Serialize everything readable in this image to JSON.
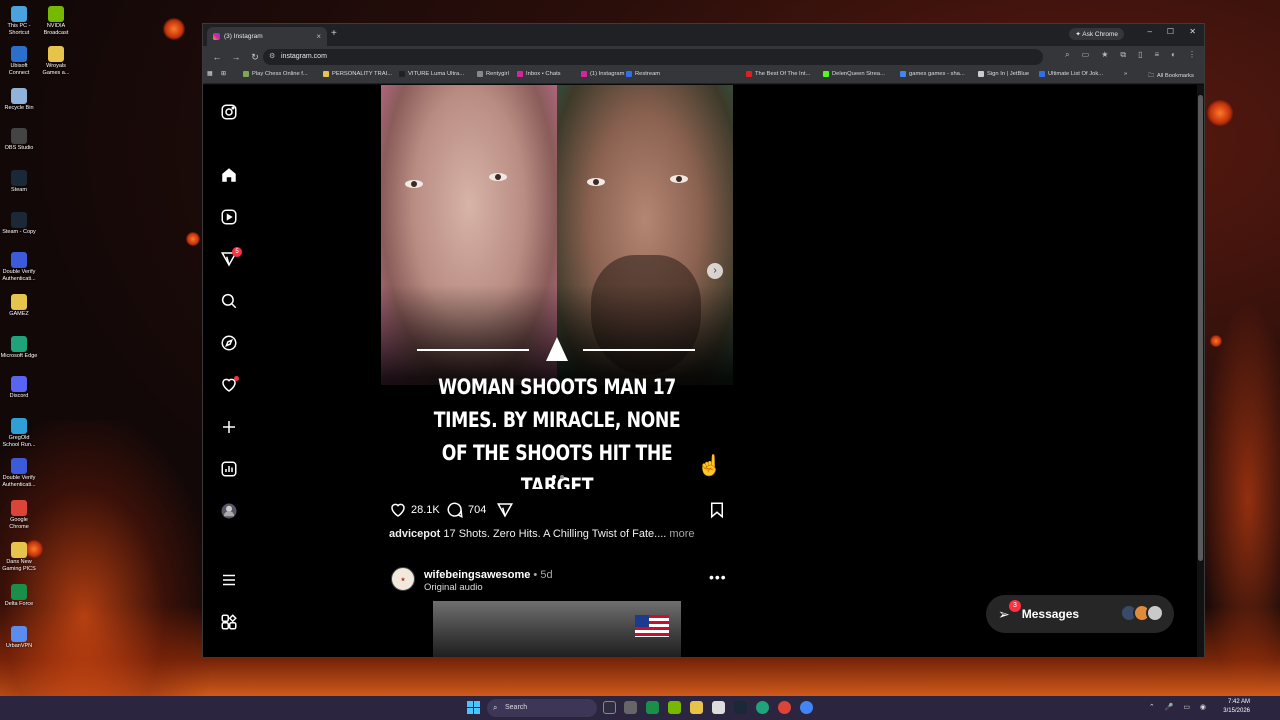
{
  "desktop": {
    "icons": [
      {
        "label": "This PC - Shortcut",
        "color": "#4aa3df"
      },
      {
        "label": "NVIDIA Broadcast",
        "color": "#76b900"
      },
      {
        "label": "Ubisoft Connect",
        "color": "#2c6ecb"
      },
      {
        "label": "Wroyals Games a...",
        "color": "#e6c34a"
      },
      {
        "label": "Recycle Bin",
        "color": "#8fb3d9"
      },
      {
        "label": "OBS Studio",
        "color": "#444"
      },
      {
        "label": "Steam",
        "color": "#1b2838"
      },
      {
        "label": "Steam - Copy",
        "color": "#1b2838"
      },
      {
        "label": "Double Verify Authenticati...",
        "color": "#3b5bdb"
      },
      {
        "label": "GAMEZ",
        "color": "#e6c34a"
      },
      {
        "label": "Microsoft Edge",
        "color": "#1fa37a"
      },
      {
        "label": "Discord",
        "color": "#5865f2"
      },
      {
        "label": "GregOld School Run...",
        "color": "#2f9fd8"
      },
      {
        "label": "Double Verify Authenticati...",
        "color": "#3b5bdb"
      },
      {
        "label": "Google Chrome",
        "color": "#db4437"
      },
      {
        "label": "Dans New Gaming PICS",
        "color": "#e6c34a"
      },
      {
        "label": "Delta Force",
        "color": "#1a8f4a"
      },
      {
        "label": "UrbanVPN",
        "color": "#5a8dee"
      }
    ]
  },
  "browser": {
    "tab_title": "(3) Instagram",
    "new_tab": "+",
    "ask_chrome": "Ask Chrome",
    "url": "instagram.com",
    "window_controls": {
      "minimize": "–",
      "maximize": "☐",
      "close": "✕"
    },
    "nav": {
      "back": "←",
      "forward": "→",
      "reload": "↻"
    },
    "bookmarks": [
      {
        "label": "Play Chess Online f...",
        "color": "#7fa650"
      },
      {
        "label": "PERSONALITY TRAI...",
        "color": "#e6c34a"
      },
      {
        "label": "VITURE Luma Ultra...",
        "color": "#222"
      },
      {
        "label": "Rentygirl",
        "color": "#888"
      },
      {
        "label": "Inbox • Chats",
        "color": "#d6249f"
      },
      {
        "label": "(1) Instagram",
        "color": "#d6249f"
      },
      {
        "label": "Restream",
        "color": "#2f6fed"
      },
      {
        "label": "The Best Of The Int...",
        "color": "#e02020"
      },
      {
        "label": "DelenQueen Strea...",
        "color": "#53fc18"
      },
      {
        "label": "games games - sha...",
        "color": "#4285f4"
      },
      {
        "label": "Sign In | JetBlue",
        "color": "#ccc"
      },
      {
        "label": "Ultimate List Of Jok...",
        "color": "#2f6fed"
      }
    ],
    "bookmarks_overflow": "»",
    "all_bookmarks": "All Bookmarks"
  },
  "instagram": {
    "sidebar": {
      "notifications_badge": "5"
    },
    "post": {
      "headline": "WOMAN SHOOTS MAN 17 TIMES. BY MIRACLE, NONE OF THE SHOOTS HIT THE TARGET",
      "likes": "28.1K",
      "comments": "704",
      "caption_user": "advicepot",
      "caption_text": " 17 Shots. Zero Hits. A Chilling Twist of Fate....",
      "caption_more": " more"
    },
    "post2": {
      "username": "wifebeingsawesome",
      "age": " • 5d",
      "audio": "Original audio",
      "menu": "•••"
    },
    "messages": {
      "label": "Messages",
      "badge": "3"
    }
  },
  "taskbar": {
    "search_placeholder": "Search",
    "time": "7:42 AM",
    "date": "3/15/2026"
  }
}
